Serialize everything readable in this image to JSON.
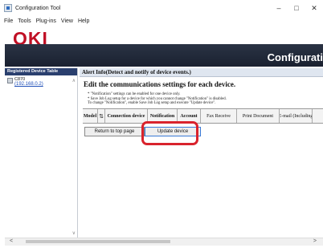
{
  "window": {
    "title": "Configuration Tool",
    "controls": {
      "minimize": "–",
      "maximize": "□",
      "close": "✕"
    }
  },
  "menu": [
    "File",
    "Tools",
    "Plug-ins",
    "View",
    "Help"
  ],
  "brand": {
    "logo": "OKI",
    "logo_color": "#c01025",
    "banner_title": "Configurati"
  },
  "sidebar": {
    "header": "Registered Device Table",
    "device": {
      "name": "C870",
      "ip": "(192.168.0.2)"
    }
  },
  "main": {
    "alert_title": "Alert Info(Detect and notify of device events.)",
    "heading": "Edit the communications settings for each device.",
    "notes": [
      "* \"Notification\" settings can be enabled for one device only.",
      "* Save Job Log setup for a device for which you cannot change \"Notification\" is disabled.",
      "  To change \"Notification\", enable Save Job Log setup and execute \"Update device\"."
    ],
    "table_headers": [
      "Model",
      "Connection device",
      "Notification",
      "Account",
      "Fax Receive",
      "Print Document",
      "E-mail (Including"
    ],
    "sort_icon": "⇅"
  },
  "buttons": {
    "return": "Return to top page",
    "update": "Update device"
  },
  "annotation_color": "#d9232d"
}
